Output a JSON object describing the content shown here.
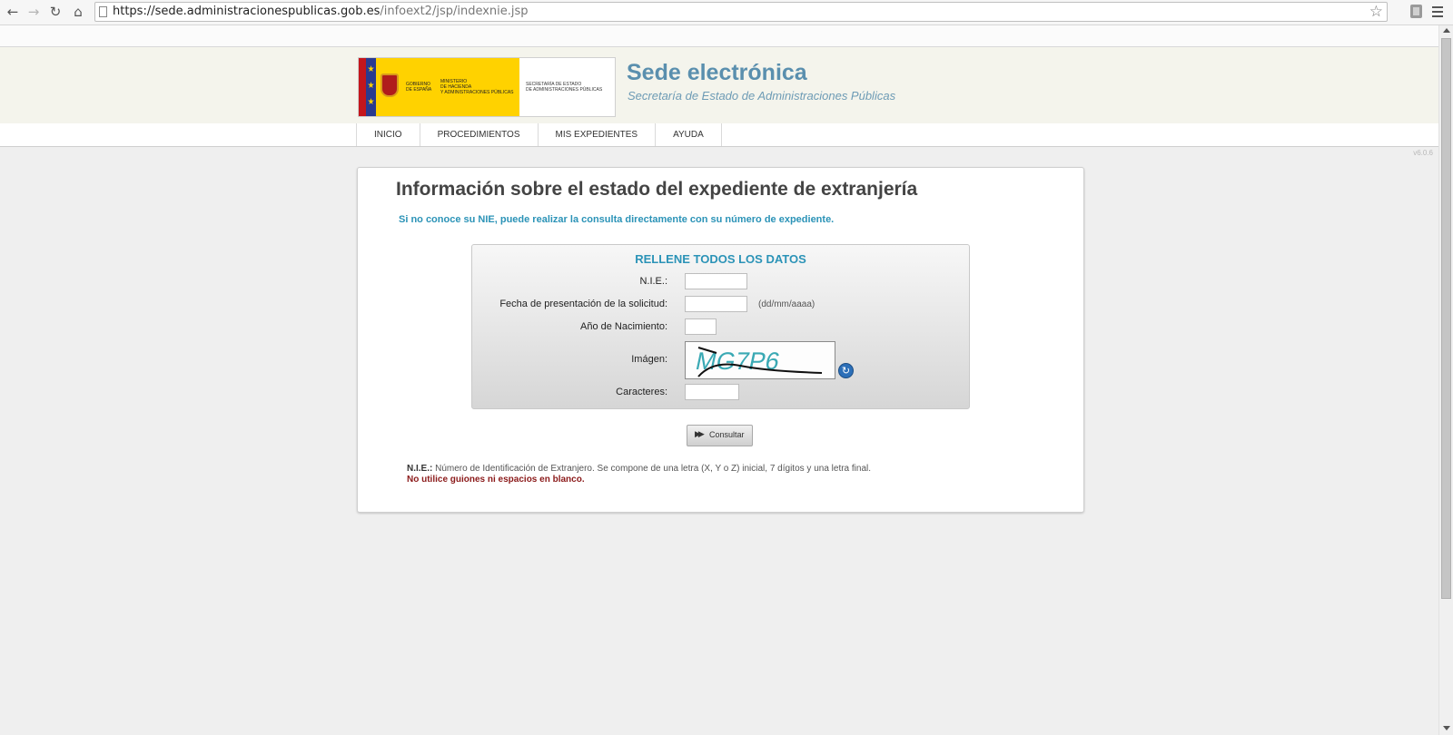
{
  "browser": {
    "url_host": "https://sede.administracionespublicas.gob.es",
    "url_path": "/infoext2/jsp/indexnie.jsp",
    "icons": [
      "back-icon",
      "forward-icon",
      "reload-icon",
      "home-icon",
      "bookmark-star-icon",
      "extension-icon",
      "menu-icon"
    ]
  },
  "header": {
    "logo_gobierno": "GOBIERNO\nDE ESPAÑA",
    "logo_ministerio": "MINISTERIO\nDE HACIENDA\nY ADMINISTRACIONES PÚBLICAS",
    "logo_secretaria": "SECRETARÍA DE ESTADO\nDE ADMINISTRACIONES PÚBLICAS",
    "title": "Sede electrónica",
    "subtitle": "Secretaría de Estado de Administraciones Públicas"
  },
  "nav": {
    "items": [
      {
        "label": "INICIO"
      },
      {
        "label": "PROCEDIMIENTOS"
      },
      {
        "label": "MIS EXPEDIENTES"
      },
      {
        "label": "AYUDA"
      }
    ]
  },
  "version": "v6.0.6",
  "content": {
    "heading": "Información sobre el estado del expediente de extranjería",
    "hint": "Si no conoce su NIE, puede realizar la consulta directamente con su número de expediente.",
    "form": {
      "heading": "RELLENE TODOS LOS DATOS",
      "nie_label": "N.I.E.:",
      "nie_value": "",
      "fecha_label": "Fecha de presentación de la solicitud:",
      "fecha_value": "",
      "fecha_format": "(dd/mm/aaaa)",
      "anio_label": "Año de Nacimiento:",
      "anio_value": "",
      "imagen_label": "Imágen:",
      "captcha_text": "MG7P6",
      "caracteres_label": "Caracteres:",
      "caracteres_value": ""
    },
    "submit_label": "Consultar",
    "note_term": "N.I.E.:",
    "note_text": " Número de Identificación de Extranjero. Se compone de una letra (X, Y o Z) inicial, 7 dígitos y una letra final.",
    "note_warning": "No utilice guiones ni espacios en blanco."
  },
  "colors": {
    "accent": "#2b93b7",
    "title": "#5a8fae",
    "warning": "#8b1a1a",
    "flag_yellow": "#ffd200",
    "flag_red": "#c4161c"
  }
}
